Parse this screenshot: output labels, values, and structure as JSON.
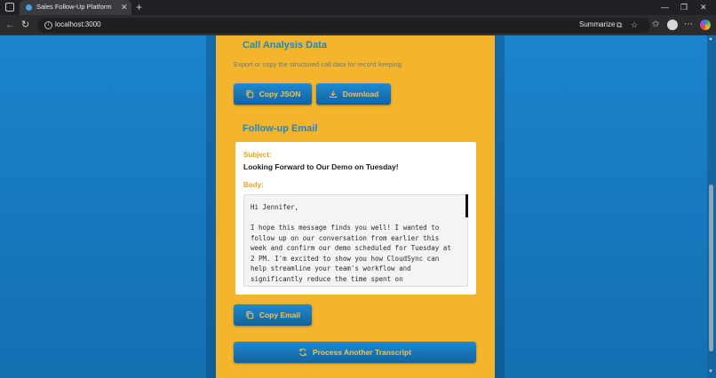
{
  "browser": {
    "tab_title": "Sales Follow-Up Platform",
    "tab_close": "✕",
    "new_tab": "+",
    "window": {
      "minimize": "—",
      "maximize": "❐",
      "close": "✕"
    },
    "url": "localhost:3000",
    "summarize_label": "Summarize",
    "icons": {
      "back": "←",
      "reload": "↻",
      "info": "i",
      "sidebar": "⧉",
      "favorite": "☆",
      "favorites": "✩",
      "more": "⋯"
    }
  },
  "analysis": {
    "title": "Call Analysis Data",
    "description": "Export or copy the structured call data for record keeping.",
    "copy_json_label": "Copy JSON",
    "download_label": "Download"
  },
  "email": {
    "title": "Follow-up Email",
    "subject_label": "Subject:",
    "subject": "Looking Forward to Our Demo on Tuesday!",
    "body_label": "Body:",
    "body": "Hi Jennifer,\n\nI hope this message finds you well! I wanted to follow up on our conversation from earlier this week and confirm our demo scheduled for Tuesday at 2 PM. I'm excited to show you how CloudSync can help streamline your team's workflow and significantly reduce the time spent on administrative tasks.",
    "copy_email_label": "Copy Email"
  },
  "process_another_label": "Process Another Transcript",
  "colors": {
    "accent": "#1f86c6",
    "panel": "#f3b52d",
    "button_text": "#f3c34e",
    "label": "#e7a521"
  }
}
